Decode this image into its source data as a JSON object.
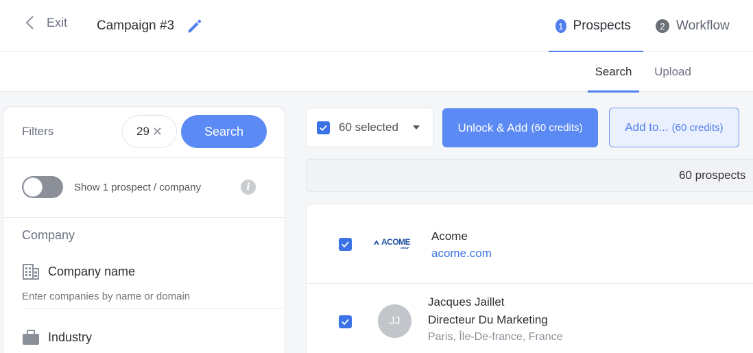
{
  "header": {
    "exit_label": "Exit",
    "campaign_title": "Campaign #3",
    "steps": [
      {
        "num": "1",
        "label": "Prospects"
      },
      {
        "num": "2",
        "label": "Workflow"
      }
    ]
  },
  "subtabs": {
    "search": "Search",
    "upload": "Upload"
  },
  "filters": {
    "title": "Filters",
    "count": "29",
    "clear_glyph": "✕",
    "search_button": "Search",
    "toggle_label": "Show 1 prospect / company",
    "info_glyph": "i",
    "section_company": "Company",
    "company_name_label": "Company name",
    "company_name_placeholder": "Enter companies by name or domain",
    "industry_label": "Industry"
  },
  "actions": {
    "selected_label": "60 selected",
    "unlock_label": "Unlock & Add",
    "unlock_credits": "(60 credits)",
    "addto_label": "Add to...",
    "addto_credits": "(60 credits)"
  },
  "results": {
    "count_label": "60 prospects",
    "company": {
      "logo_text": "ACOME",
      "logo_sub": "GROUP",
      "name": "Acome",
      "domain": "acome.com"
    },
    "person": {
      "initials": "JJ",
      "name": "Jacques Jaillet",
      "title": "Directeur Du Marketing",
      "location": "Paris, Île-De-france, France"
    }
  },
  "colors": {
    "accent": "#4f7fef",
    "button": "#5b8af5",
    "link": "#3b73e6"
  }
}
